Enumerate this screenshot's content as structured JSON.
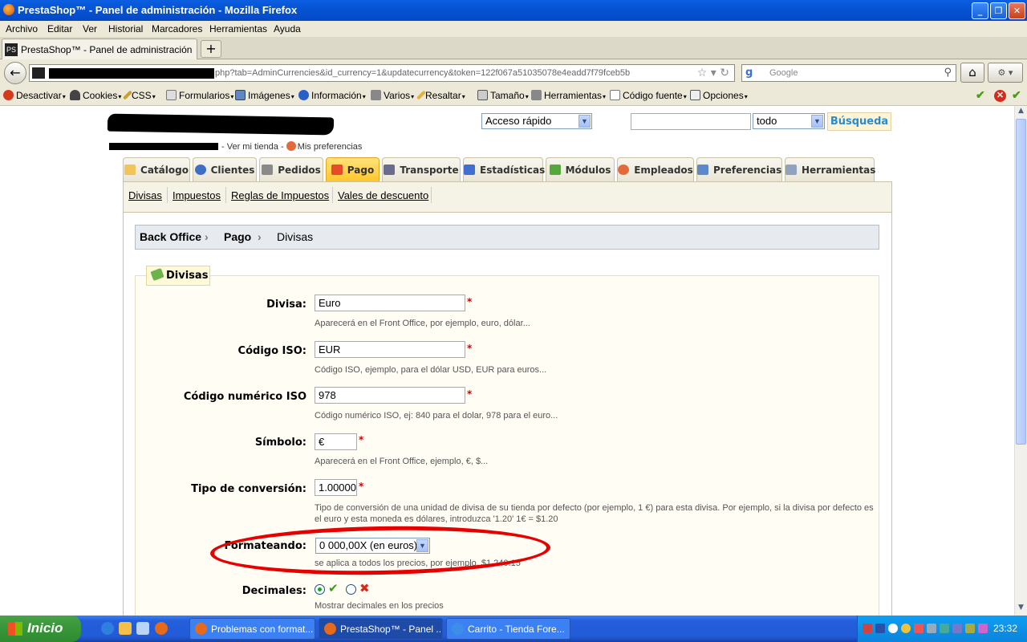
{
  "window": {
    "title": "PrestaShop™ - Panel de administración - Mozilla Firefox",
    "controls": {
      "minimize": "_",
      "restore": "❐",
      "close": "✕"
    }
  },
  "menu": [
    "Archivo",
    "Editar",
    "Ver",
    "Historial",
    "Marcadores",
    "Herramientas",
    "Ayuda"
  ],
  "browser": {
    "tab_title": "PrestaShop™ - Panel de administración",
    "new_tab": "+",
    "url_visible": "php?tab=AdminCurrencies&id_currency=1&updatecurrency&token=122f067a51035078e4eadd7f79fceb5b",
    "search_placeholder": "Google"
  },
  "devtoolbar": [
    "Desactivar",
    "Cookies",
    "CSS",
    "Formularios",
    "Imágenes",
    "Información",
    "Varios",
    "Resaltar",
    "Tamaño",
    "Herramientas",
    "Código fuente",
    "Opciones"
  ],
  "header": {
    "view_shop": "- Ver mi tienda -",
    "my_prefs": "Mis preferencias",
    "quick_access": "Acceso rápido",
    "search_scope": "todo",
    "search_button": "Búsqueda"
  },
  "main_tabs": [
    "Catálogo",
    "Clientes",
    "Pedidos",
    "Pago",
    "Transporte",
    "Estadísticas",
    "Módulos",
    "Empleados",
    "Preferencias",
    "Herramientas"
  ],
  "active_tab": "Pago",
  "subnav": [
    "Divisas",
    "Impuestos",
    "Reglas de Impuestos",
    "Vales de descuento"
  ],
  "breadcrumb": [
    "Back Office",
    "Pago",
    "Divisas"
  ],
  "form": {
    "legend": "Divisas",
    "fields": [
      {
        "label": "Divisa:",
        "value": "Euro",
        "hint": "Aparecerá en el Front Office, por ejemplo, euro, dólar..."
      },
      {
        "label": "Código ISO:",
        "value": "EUR",
        "hint": "Código ISO, ejemplo, para el dólar USD, EUR para euros..."
      },
      {
        "label": "Código numérico ISO",
        "value": "978",
        "hint": "Código numérico ISO, ej: 840 para el dolar, 978 para el euro..."
      },
      {
        "label": "Símbolo:",
        "value": "€",
        "hint": "Aparecerá en el Front Office, ejemplo, €, $..."
      },
      {
        "label": "Tipo de conversión:",
        "value": "1.00000",
        "hint": "Tipo de conversión de una unidad de divisa de su tienda por defecto (por ejemplo, 1 €) para esta divisa. Por ejemplo, si la divisa por defecto es el euro y esta moneda es dólares, introduzca '1.20' 1€ = $1.20"
      }
    ],
    "format": {
      "label": "Formateando:",
      "value": "0 000,00X (en euros)",
      "hint": "se aplica a todos los precios, por ejemplo, $1,240.15"
    },
    "decimals": {
      "label": "Decimales:",
      "hint": "Mostrar decimales en los precios",
      "selected": "yes"
    },
    "required_mark": "*"
  },
  "taskbar": {
    "start": "Inicio",
    "items": [
      "Problemas con format...",
      "PrestaShop™ - Panel ...",
      "Carrito - Tienda Fore..."
    ],
    "clock": "23:32"
  }
}
